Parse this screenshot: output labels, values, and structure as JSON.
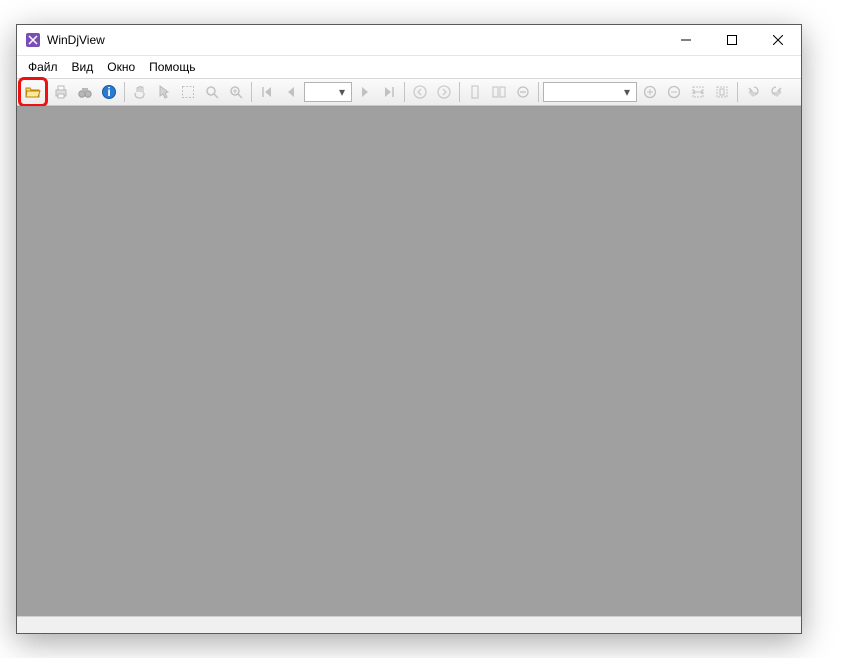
{
  "title": "WinDjView",
  "menu": {
    "file": "Файл",
    "view": "Вид",
    "window": "Окно",
    "help": "Помощь"
  },
  "toolbar": {
    "open": "open",
    "print": "print",
    "find": "find",
    "info": "info",
    "hand": "hand",
    "select": "select",
    "marquee": "marquee",
    "magnify": "magnify",
    "loupe": "loupe",
    "first": "first",
    "prev": "prev",
    "pageCombo": "",
    "next": "next",
    "last": "last",
    "back": "back",
    "fwd": "forward",
    "single": "single",
    "facing": "facing",
    "continuous": "continuous",
    "zoomCombo": "",
    "zoomin": "zoomin",
    "zoomout": "zoomout",
    "fitwidth": "fitwidth",
    "fitpage": "fitpage",
    "rotleft": "rotate-left",
    "rotright": "rotate-right"
  }
}
